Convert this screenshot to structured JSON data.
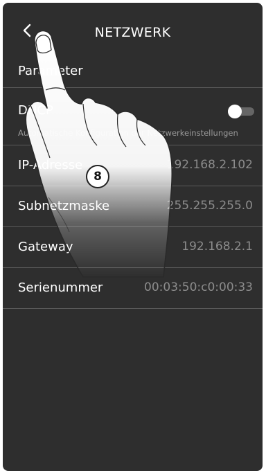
{
  "header": {
    "title": "NETZWERK",
    "back_icon": "chevron-left-icon"
  },
  "rows": {
    "parameter_label": "Parameter",
    "dhcp_label": "DHCP",
    "dhcp_toggle_on": false,
    "dhcp_description": "Automatische Konfiguration der Netzwerkeinstellungen",
    "ip_label": "IP-Adresse",
    "ip_value": "192.168.2.102",
    "subnet_label": "Subnetzmaske",
    "subnet_value": "255.255.255.0",
    "gateway_label": "Gateway",
    "gateway_value": "192.168.2.1",
    "serial_label": "Serienummer",
    "serial_value": "00:03:50:c0:00:33"
  },
  "annotation": {
    "callout_number": "8"
  },
  "colors": {
    "background": "#2e2e2e",
    "divider": "#5a5a5a",
    "value_text": "#8c8c8c"
  }
}
